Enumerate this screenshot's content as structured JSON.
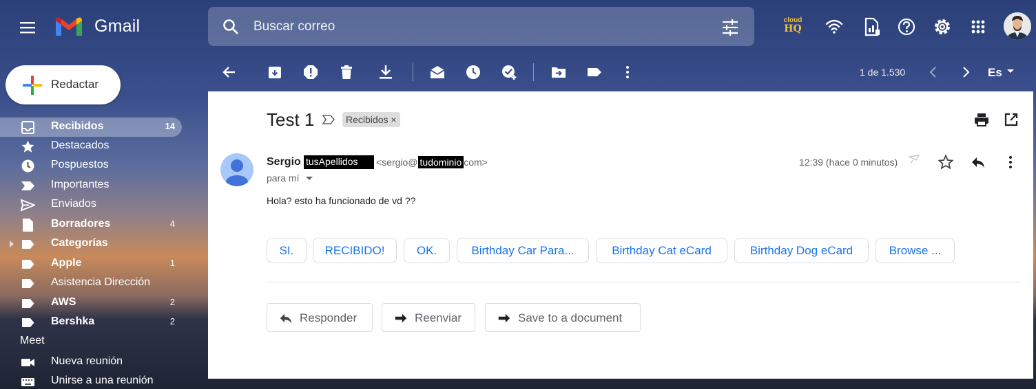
{
  "app": {
    "name": "Gmail"
  },
  "search": {
    "placeholder": "Buscar correo"
  },
  "cloudhq": {
    "line1": "cloud",
    "line2": "HQ"
  },
  "compose": {
    "label": "Redactar"
  },
  "sidebar": {
    "items": [
      {
        "label": "Recibidos",
        "count": "14",
        "icon": "inbox-icon",
        "bold": true,
        "active": true
      },
      {
        "label": "Destacados",
        "count": "",
        "icon": "star-icon",
        "bold": false
      },
      {
        "label": "Pospuestos",
        "count": "",
        "icon": "clock-icon",
        "bold": false
      },
      {
        "label": "Importantes",
        "count": "",
        "icon": "important-icon",
        "bold": false
      },
      {
        "label": "Enviados",
        "count": "",
        "icon": "send-icon",
        "bold": false
      },
      {
        "label": "Borradores",
        "count": "4",
        "icon": "draft-icon",
        "bold": true
      },
      {
        "label": "Categorías",
        "count": "",
        "icon": "label-icon",
        "bold": true
      },
      {
        "label": "Apple",
        "count": "1",
        "icon": "label-icon",
        "bold": true
      },
      {
        "label": "Asistencia Dirección",
        "count": "",
        "icon": "label-icon",
        "bold": false
      },
      {
        "label": "AWS",
        "count": "2",
        "icon": "label-icon",
        "bold": true
      },
      {
        "label": "Bershka",
        "count": "2",
        "icon": "label-icon",
        "bold": true
      }
    ]
  },
  "meet": {
    "title": "Meet",
    "items": [
      {
        "label": "Nueva reunión",
        "icon": "video-icon"
      },
      {
        "label": "Unirse a una reunión",
        "icon": "keyboard-icon"
      }
    ]
  },
  "toolbar": {
    "pager": "1 de 1.530",
    "language": "Es"
  },
  "email": {
    "subject": "Test 1",
    "label_chip": "Recibidos",
    "label_chip_close": "×",
    "sender_first": "Sergio",
    "sender_redacted": "tusApellidos",
    "email_prefix": "<sergio@",
    "email_redacted": "tudominio",
    "email_suffix": "com>",
    "to": "para mí",
    "timestamp": "12:39 (hace 0 minutos)",
    "body": "Hola? esto ha funcionado de vd ??"
  },
  "smart_replies": [
    "SI.",
    "RECIBIDO!",
    "OK.",
    "Birthday Car Para...",
    "Birthday Cat eCard",
    "Birthday Dog eCard",
    "Browse ..."
  ],
  "actions": {
    "reply": "Responder",
    "forward": "Reenviar",
    "save": "Save to a document"
  },
  "colors": {
    "accent_blue": "#1a73e8",
    "sender_avatar": "#a8c7fa",
    "pane_bg": "#ffffff"
  }
}
